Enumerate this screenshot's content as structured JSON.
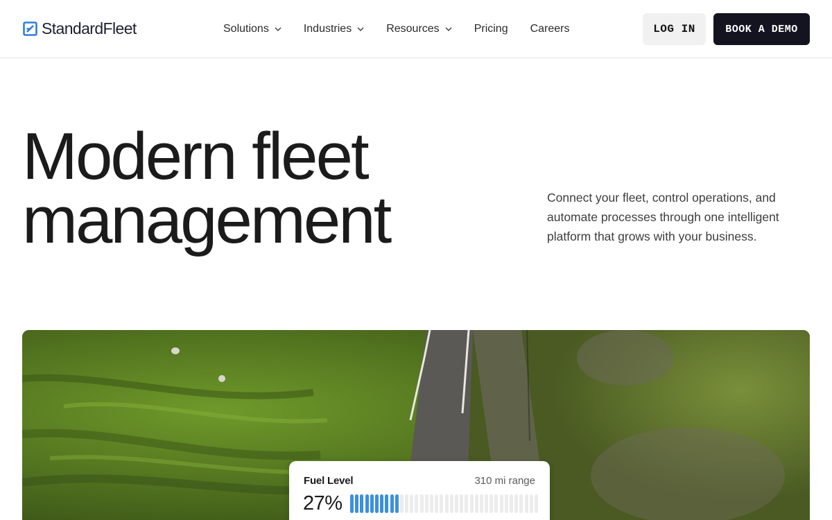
{
  "header": {
    "logo_text": "StandardFleet",
    "nav": [
      {
        "label": "Solutions",
        "has_dropdown": true
      },
      {
        "label": "Industries",
        "has_dropdown": true
      },
      {
        "label": "Resources",
        "has_dropdown": true
      },
      {
        "label": "Pricing",
        "has_dropdown": false
      },
      {
        "label": "Careers",
        "has_dropdown": false
      }
    ],
    "login_label": "LOG IN",
    "demo_label": "BOOK A DEMO"
  },
  "hero": {
    "title_line1": "Modern fleet",
    "title_line2": "management",
    "subtitle": "Connect your fleet, control operations, and automate processes through one intelligent platform that grows with your business."
  },
  "fuel_card": {
    "label": "Fuel Level",
    "range": "310 mi range",
    "percent_text": "27%",
    "level_fraction": 0.27,
    "bar_active_color": "#3b8fe0",
    "bar_inactive_color": "#ececec"
  },
  "colors": {
    "brand_accent": "#2f7de1",
    "dark_button": "#141421",
    "light_button": "#f1f1f1"
  }
}
